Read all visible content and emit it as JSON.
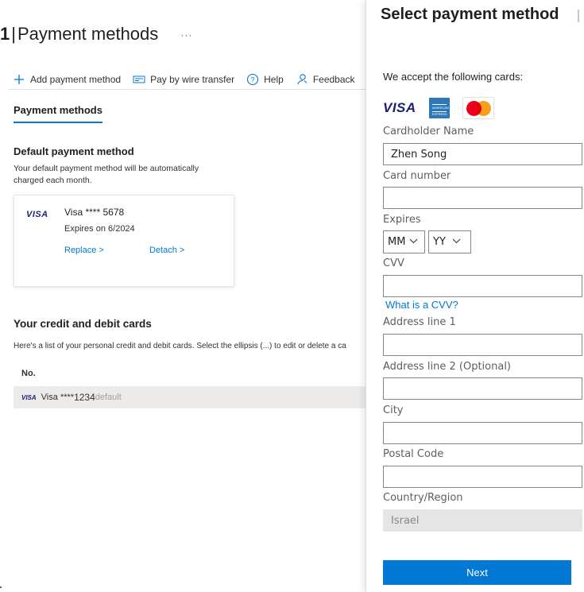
{
  "page": {
    "title_num": "1",
    "title_sep": "|",
    "title_text": "Payment methods",
    "title_more": "···"
  },
  "commands": {
    "add": "Add payment method",
    "wire": "Pay by wire transfer",
    "help": "Help",
    "feedback": "Feedback"
  },
  "tabs": {
    "active": "Payment methods"
  },
  "default_section": {
    "heading": "Default payment method",
    "description": "Your default payment method will be automatically charged each month.",
    "card": {
      "brand": "VISA",
      "number": "Visa **** 5678",
      "expires": "Expires on 6/2024",
      "replace": "Replace >",
      "detach": "Detach >"
    }
  },
  "cards_section": {
    "heading": "Your credit and debit cards",
    "description": "Here's a list of your personal credit and debit cards. Select the ellipsis (...) to edit or delete a ca",
    "col_no": "No.",
    "rows": [
      {
        "brand": "VISA",
        "name": "Visa",
        "stars": "****",
        "last4": "1234",
        "tag": "default"
      }
    ]
  },
  "panel": {
    "title": "Select payment method",
    "accept_text": "We accept the following cards:",
    "logos": {
      "visa": "VISA",
      "amex": "AMERICAN EXPRESS"
    },
    "fields": {
      "cardholder_label": "Cardholder Name",
      "cardholder_value": "Zhen Song",
      "card_number_label": "Card number",
      "card_number_value": "",
      "expires_label": "Expires",
      "month_value": "MM",
      "year_value": "YY",
      "cvv_label": "CVV",
      "cvv_value": "",
      "cvv_link": "What is a CVV?",
      "address1_label": "Address line 1",
      "address2_label": "Address line 2 (Optional)",
      "city_label": "City",
      "postal_label": "Postal Code",
      "country_label": "Country/Region",
      "country_value": "Israel"
    },
    "next": "Next"
  },
  "colors": {
    "accent": "#0078d4",
    "visa_blue": "#1a1f71",
    "mc_red": "#eb001b",
    "mc_orange": "#f79e1b",
    "amex_blue": "#2e77bb"
  }
}
